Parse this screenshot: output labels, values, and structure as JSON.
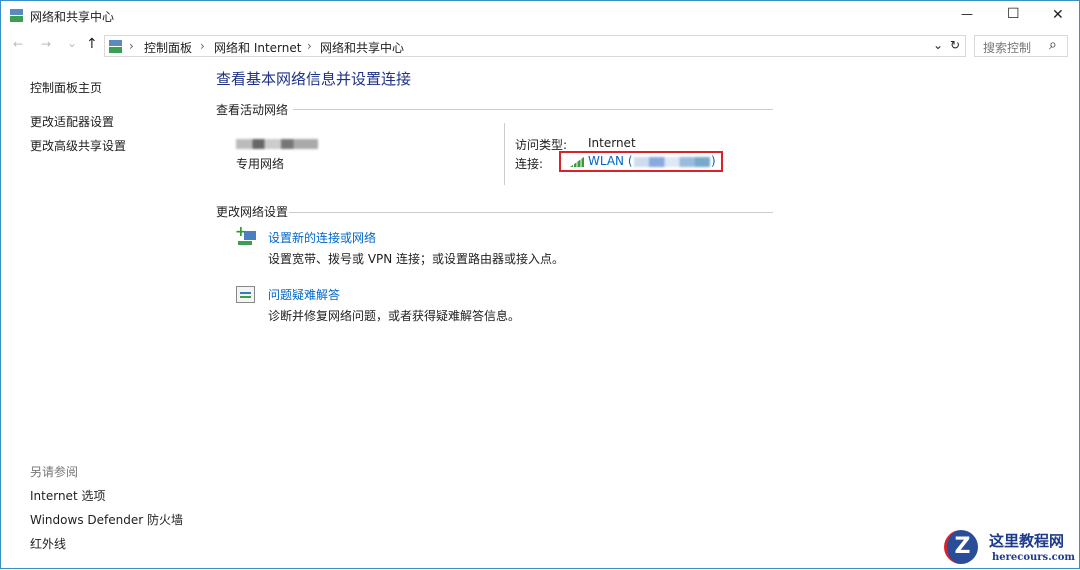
{
  "window": {
    "title": "网络和共享中心",
    "minimize": "—",
    "maximize": "☐",
    "close": "✕"
  },
  "nav": {
    "back": "←",
    "forward": "→",
    "recent": "⌄",
    "up": "↑",
    "breadcrumb": [
      "控制面板",
      "网络和 Internet",
      "网络和共享中心"
    ],
    "sep": "›",
    "dropdown": "⌄",
    "refresh": "↻",
    "search_placeholder": "搜索控制",
    "search_icon": "⌕"
  },
  "sidebar": {
    "items": [
      "控制面板主页",
      "更改适配器设置",
      "更改高级共享设置"
    ],
    "see_also_title": "另请参阅",
    "see_also": [
      "Internet 选项",
      "Windows Defender 防火墙",
      "红外线"
    ]
  },
  "main": {
    "title": "查看基本网络信息并设置连接",
    "active_title": "查看活动网络",
    "network_type": "专用网络",
    "access_label": "访问类型:",
    "access_value": "Internet",
    "connect_label": "连接:",
    "wlan_label": "WLAN (",
    "wlan_close": ")",
    "change_title": "更改网络设置",
    "tasks": [
      {
        "title": "设置新的连接或网络",
        "desc": "设置宽带、拨号或 VPN 连接；或设置路由器或接入点。"
      },
      {
        "title": "问题疑难解答",
        "desc": "诊断并修复网络问题，或者获得疑难解答信息。"
      }
    ]
  },
  "watermark": {
    "title": "这里教程网",
    "url": "herecours.com",
    "letter": "Z"
  }
}
